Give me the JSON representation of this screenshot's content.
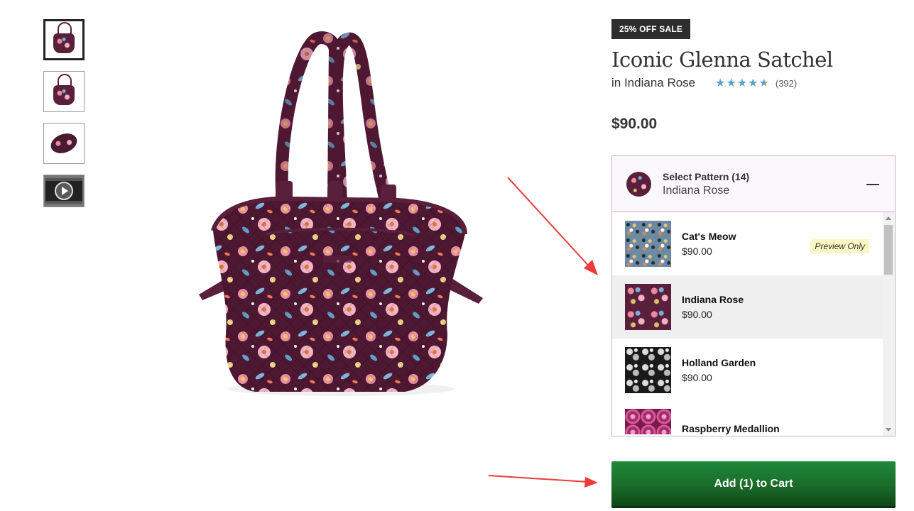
{
  "badge": "25% OFF SALE",
  "product": {
    "title": "Iconic Glenna Satchel",
    "color_line": "in Indiana Rose",
    "rating": 4.5,
    "review_count": "(392)",
    "price": "$90.00"
  },
  "pattern_selector": {
    "label": "Select Pattern (14)",
    "selected": "Indiana Rose",
    "items": [
      {
        "name": "Cat's Meow",
        "price": "$90.00",
        "tag": "Preview Only"
      },
      {
        "name": "Indiana Rose",
        "price": "$90.00"
      },
      {
        "name": "Holland Garden",
        "price": "$90.00"
      },
      {
        "name": "Raspberry Medallion",
        "price": ""
      }
    ]
  },
  "cart": {
    "label": "Add (1) to Cart"
  },
  "colors": {
    "star": "#5aa3c6",
    "cart_green": "#1b6b2a",
    "annotation_arrow": "#ee3a3a"
  },
  "icons": [
    "play-icon",
    "collapse-minus-icon",
    "star-icon",
    "scroll-up-icon",
    "scroll-down-icon"
  ]
}
